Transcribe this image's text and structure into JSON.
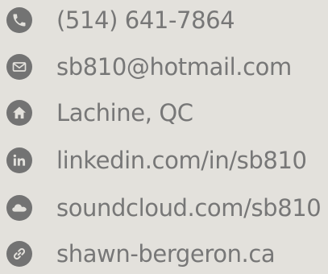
{
  "contacts": [
    {
      "icon": "phone-icon",
      "text": "(514) 641-7864"
    },
    {
      "icon": "envelope-icon",
      "text": "sb810@hotmail.com"
    },
    {
      "icon": "home-icon",
      "text": "Lachine, QC"
    },
    {
      "icon": "linkedin-icon",
      "text": "linkedin.com/in/sb810"
    },
    {
      "icon": "soundcloud-icon",
      "text": "soundcloud.com/sb810"
    },
    {
      "icon": "link-icon",
      "text": "shawn-bergeron.ca"
    }
  ],
  "colors": {
    "background": "#e3e1dc",
    "icon_circle": "#737373",
    "icon_glyph": "#e3e1dc",
    "text": "#777777"
  }
}
